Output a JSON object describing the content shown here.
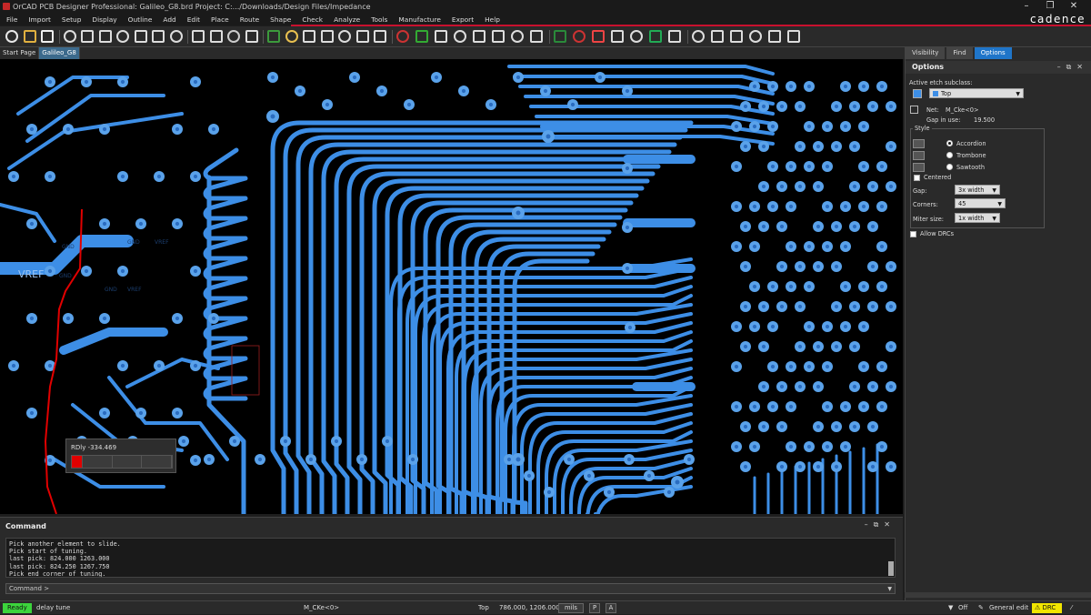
{
  "window": {
    "title": "OrCAD PCB Designer Professional: Galileo_G8.brd  Project: C:.../Downloads/Design Files/Impedance",
    "brand": "cadence"
  },
  "menu": [
    "File",
    "Import",
    "Setup",
    "Display",
    "Outline",
    "Add",
    "Edit",
    "Place",
    "Route",
    "Shape",
    "Check",
    "Analyze",
    "Tools",
    "Manufacture",
    "Export",
    "Help"
  ],
  "tabs": [
    {
      "label": "Start Page",
      "active": false
    },
    {
      "label": "Galileo_G8",
      "active": true
    }
  ],
  "canvas": {
    "tooltip": {
      "label": "RDly -334.469",
      "fill_fraction": 0.08
    },
    "labels": [
      "VREF",
      "GND",
      "VREF",
      "GND",
      "GND",
      "VREF",
      "GND"
    ]
  },
  "right_panel": {
    "tabs": [
      "Visibility",
      "Find",
      "Options"
    ],
    "active_tab": "Options",
    "title": "Options",
    "active_etch_label": "Active etch subclass:",
    "active_etch_value": "Top",
    "net_label": "Net:",
    "net_value": "M_Cke<0>",
    "gap_in_use_label": "Gap in use:",
    "gap_in_use_value": "19.500",
    "style_title": "Style",
    "style_options": [
      {
        "label": "Accordion",
        "selected": true
      },
      {
        "label": "Trombone",
        "selected": false
      },
      {
        "label": "Sawtooth",
        "selected": false
      }
    ],
    "centered_label": "Centered",
    "gap_label": "Gap:",
    "gap_value": "3x width",
    "corners_label": "Corners:",
    "corners_value": "45",
    "miter_label": "Miter size:",
    "miter_value": "1x width",
    "allow_drcs_label": "Allow DRCs"
  },
  "command": {
    "title": "Command",
    "log": [
      "Pick another element to slide.",
      "Pick start of tuning.",
      "last pick:  824.000 1263.000",
      "last pick:  824.250 1267.750",
      "Pick end corner of tuning."
    ],
    "prompt": "Command >"
  },
  "status": {
    "ready": "Ready",
    "mode": "delay tune",
    "net": "M_CKe<0>",
    "layer": "Top",
    "coords": "786.000, 1206.000",
    "units": "mils",
    "p_btn": "P",
    "a_btn": "A",
    "filter": "Off",
    "general_edit": "General edit",
    "drc": "DRC"
  },
  "colors": {
    "trace": "#3d8ee6",
    "pad": "#5aa2ea",
    "highlight": "#e10000",
    "accent": "#1f75c9",
    "ready": "#3cd43c",
    "drc": "#f2e600"
  }
}
